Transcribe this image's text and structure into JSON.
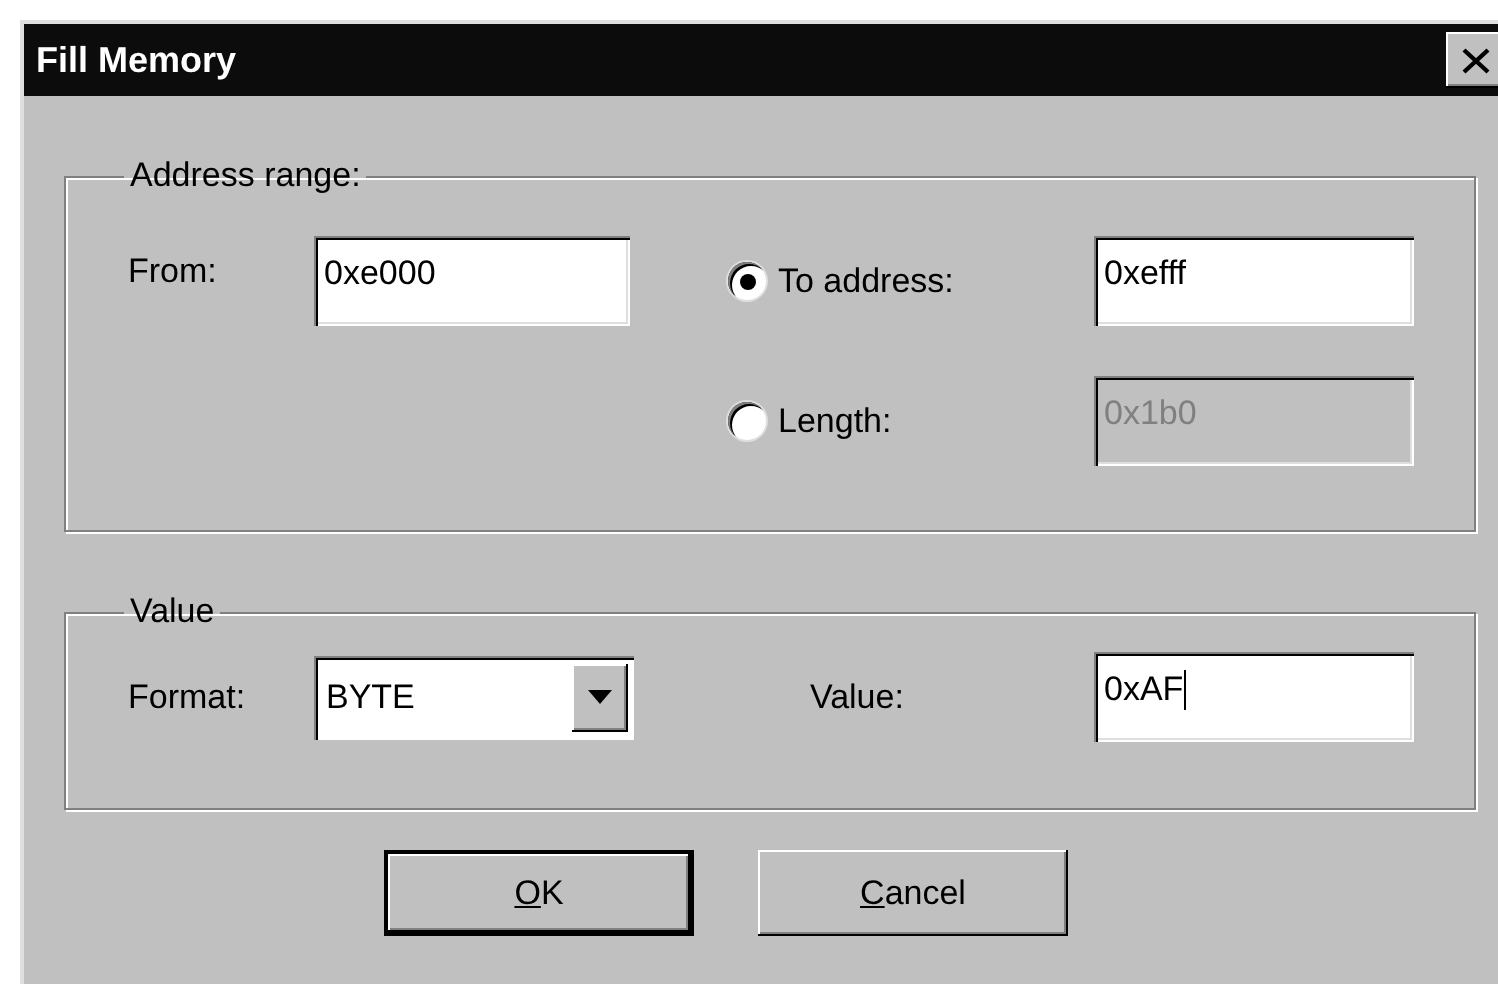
{
  "window": {
    "title": "Fill Memory"
  },
  "address_range": {
    "legend": "Address range:",
    "from": {
      "label": "From:",
      "value": "0xe000"
    },
    "options": [
      {
        "label": "To address:",
        "selected": true,
        "value": "0xefff",
        "disabled": false
      },
      {
        "label": "Length:",
        "selected": false,
        "value": "0x1b0",
        "disabled": true
      }
    ]
  },
  "value_group": {
    "legend": "Value",
    "format": {
      "label": "Format:",
      "value": "BYTE"
    },
    "value": {
      "label": "Value:",
      "value": "0xAF",
      "focused": true
    }
  },
  "buttons": [
    {
      "label": "OK",
      "first_letter_underlined": true,
      "default": true
    },
    {
      "label": "Cancel",
      "first_letter_underlined": true,
      "default": false
    }
  ]
}
